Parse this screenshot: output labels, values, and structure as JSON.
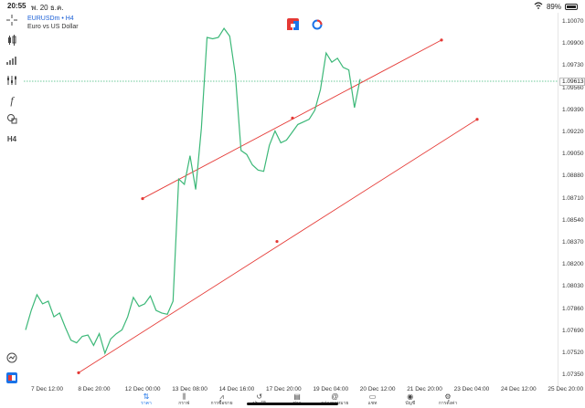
{
  "status": {
    "time": "20:55",
    "date": "พ. 20 ธ.ค.",
    "battery": "89%"
  },
  "symbol": {
    "name": "EURUSDm • H4",
    "description": "Euro vs US Dollar"
  },
  "timeframe": "H4",
  "price_tag": "1.09613",
  "y_ticks": [
    "1.10070",
    "1.09900",
    "1.09730",
    "1.09560",
    "1.09390",
    "1.09220",
    "1.09050",
    "1.08880",
    "1.08710",
    "1.08540",
    "1.08370",
    "1.08200",
    "1.08030",
    "1.07860",
    "1.07690",
    "1.07520",
    "1.07350"
  ],
  "x_ticks": [
    "7 Dec 12:00",
    "8 Dec 20:00",
    "12 Dec 00:00",
    "13 Dec 08:00",
    "14 Dec 16:00",
    "17 Dec 20:00",
    "19 Dec 04:00",
    "20 Dec 12:00",
    "21 Dec 20:00",
    "23 Dec 04:00",
    "24 Dec 12:00",
    "25 Dec 20:00"
  ],
  "colors": {
    "series": "#3cb878",
    "channel": "#e53935",
    "accent": "#1a73e8",
    "priceline": "#3cb878"
  },
  "chart_data": {
    "type": "line",
    "xlabel": "",
    "ylabel": "",
    "ylim": [
      1.0726,
      1.1014
    ],
    "grid": false,
    "x": [
      0,
      1,
      2,
      3,
      4,
      5,
      6,
      7,
      8,
      9,
      10,
      11,
      12,
      13,
      14,
      15,
      16,
      17,
      18,
      19,
      20,
      21,
      22,
      23,
      24,
      25,
      26,
      27,
      28,
      29,
      30,
      31,
      32,
      33,
      34,
      35,
      36,
      37,
      38,
      39,
      40,
      41,
      42,
      43,
      44,
      45,
      46,
      47,
      48,
      49,
      50,
      51,
      52,
      53,
      54,
      55,
      56,
      57,
      58,
      59,
      60,
      61,
      62,
      63
    ],
    "series": [
      {
        "values": [
          1.077,
          1.0785,
          1.0797,
          1.079,
          1.0792,
          1.078,
          1.0783,
          1.0772,
          1.0762,
          1.076,
          1.0765,
          1.0766,
          1.0758,
          1.0767,
          1.0752,
          1.0763,
          1.0767,
          1.077,
          1.078,
          1.0795,
          1.0788,
          1.079,
          1.0796,
          1.0785,
          1.0783,
          1.0782,
          1.0792,
          1.0886,
          1.0882,
          1.0904,
          1.0878,
          1.0925,
          1.0995,
          1.0994,
          1.0995,
          1.1002,
          1.0996,
          1.0966,
          1.0908,
          1.0905,
          1.0897,
          1.0893,
          1.0892,
          1.0912,
          1.0923,
          1.0914,
          1.0916,
          1.0922,
          1.0928,
          1.093,
          1.0932,
          1.0939,
          1.0955,
          1.0983,
          1.0976,
          1.0979,
          1.0972,
          1.097,
          1.0941,
          1.0963
        ]
      }
    ],
    "channel_lines": [
      {
        "start": {
          "x": "11 Dec",
          "y": 1.0871
        },
        "mid": {
          "x": "17 Dec 20:00",
          "y": 1.0933
        },
        "end": {
          "x": "21 Dec 20:00",
          "y": 1.0993
        }
      },
      {
        "start": {
          "x": "8 Dec",
          "y": 1.0737
        },
        "mid": {
          "x": "15 Dec",
          "y": 1.0838
        },
        "end": {
          "x": "23 Dec 04:00",
          "y": 1.0932
        }
      }
    ],
    "current_price": 1.09613
  },
  "toolbar": {
    "crosshair": "crosshair-icon",
    "candles": "candlestick-icon",
    "indicators": "indicators-icon",
    "objects": "objects-icon",
    "function": "f",
    "shapes": "shapes-icon",
    "timeframe": "H4"
  },
  "nav": [
    {
      "label": "ราคา",
      "icon": "quotes-icon",
      "active": true
    },
    {
      "label": "กราฟ",
      "icon": "chart-icon",
      "active": false
    },
    {
      "label": "การซื้อขาย",
      "icon": "trade-icon",
      "active": false
    },
    {
      "label": "ประวัติ",
      "icon": "history-icon",
      "active": false
    },
    {
      "label": "ข่าว",
      "icon": "news-icon",
      "active": false
    },
    {
      "label": "กล่องจดหมาย",
      "icon": "mailbox-icon",
      "active": false
    },
    {
      "label": "แชท",
      "icon": "chat-icon",
      "active": false
    },
    {
      "label": "บัญชี",
      "icon": "account-icon",
      "active": false
    },
    {
      "label": "การตั้งค่า",
      "icon": "settings-icon",
      "active": false
    }
  ]
}
